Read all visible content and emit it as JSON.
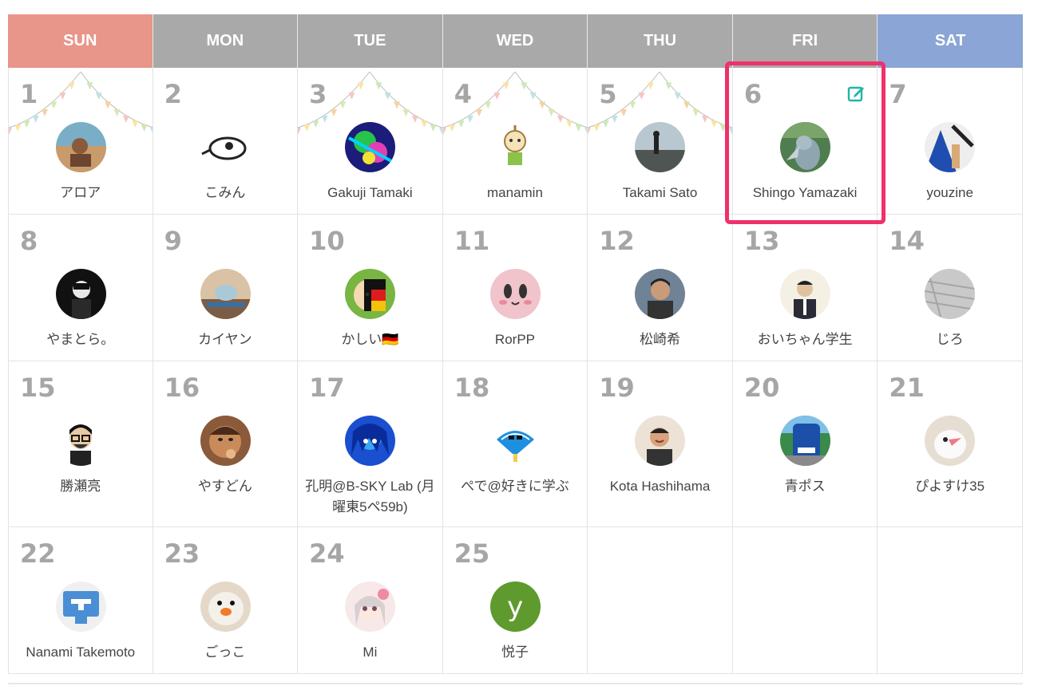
{
  "weekdays": [
    "SUN",
    "MON",
    "TUE",
    "WED",
    "THU",
    "FRI",
    "SAT"
  ],
  "weeks": [
    [
      {
        "day": "1",
        "name": "アロア",
        "avatar": "photo-kitchen",
        "bunting": true
      },
      {
        "day": "2",
        "name": "こみん",
        "avatar": "bird-sketch",
        "bunting": false
      },
      {
        "day": "3",
        "name": "Gakuji Tamaki",
        "avatar": "colorful-art",
        "bunting": true
      },
      {
        "day": "4",
        "name": "manamin",
        "avatar": "cartoon-character",
        "bunting": true
      },
      {
        "day": "5",
        "name": "Takami Sato",
        "avatar": "photo-beach",
        "bunting": true
      },
      {
        "day": "6",
        "name": "Shingo Yamazaki",
        "avatar": "shoebill-bird",
        "bunting": false,
        "editable": true
      },
      {
        "day": "7",
        "name": "youzine",
        "avatar": "photo-acrobat",
        "bunting": false
      }
    ],
    [
      {
        "day": "8",
        "name": "やまとら。",
        "avatar": "dark-portrait"
      },
      {
        "day": "9",
        "name": "カイヤン",
        "avatar": "cat-photo"
      },
      {
        "day": "10",
        "name": "かしい🇩🇪",
        "avatar": "german-flag-face"
      },
      {
        "day": "11",
        "name": "RorPP",
        "avatar": "pink-face"
      },
      {
        "day": "12",
        "name": "松崎希",
        "avatar": "person-photo"
      },
      {
        "day": "13",
        "name": "おいちゃん学生",
        "avatar": "suit-photo"
      },
      {
        "day": "14",
        "name": "じろ",
        "avatar": "paper-texture"
      }
    ],
    [
      {
        "day": "15",
        "name": "勝瀬亮",
        "avatar": "glasses-illustration"
      },
      {
        "day": "16",
        "name": "やすどん",
        "avatar": "cartoon-man"
      },
      {
        "day": "17",
        "name": "孔明@B-SKY Lab (月曜東5ペ59b)",
        "avatar": "blue-anime"
      },
      {
        "day": "18",
        "name": "ぺで@好きに学ぶ",
        "avatar": "fan-icon"
      },
      {
        "day": "19",
        "name": "Kota Hashihama",
        "avatar": "smiling-man"
      },
      {
        "day": "20",
        "name": "青ポス",
        "avatar": "blue-postbox"
      },
      {
        "day": "21",
        "name": "ぴよすけ35",
        "avatar": "white-bird"
      }
    ],
    [
      {
        "day": "22",
        "name": "Nanami Takemoto",
        "avatar": "blue-t-logo"
      },
      {
        "day": "23",
        "name": "ごっこ",
        "avatar": "duck-plush"
      },
      {
        "day": "24",
        "name": "Mi",
        "avatar": "pink-anime-girl"
      },
      {
        "day": "25",
        "name": "悦子",
        "avatar": "letter-y",
        "letter": "y"
      },
      null,
      null,
      null
    ]
  ],
  "colors": {
    "sun": "#e8958a",
    "sat": "#8aa5d6",
    "weekday": "#a9a9a9",
    "highlight": "#f0306a",
    "edit": "#1fb5a5"
  }
}
